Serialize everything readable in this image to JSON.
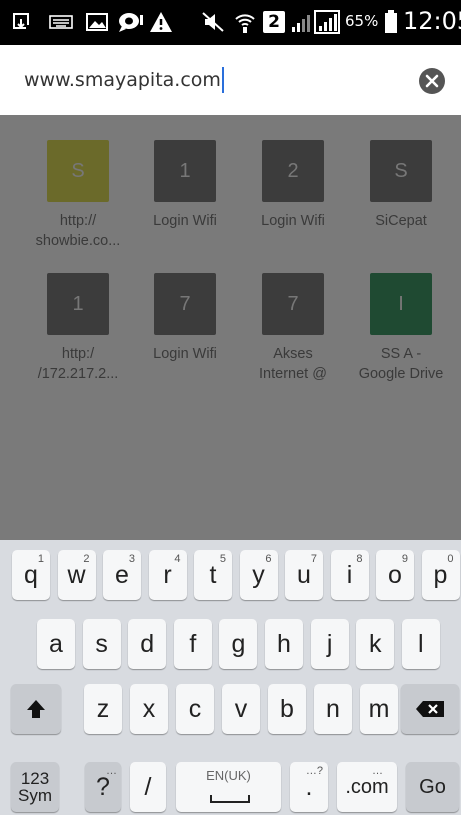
{
  "status_bar": {
    "battery_percent": "65%",
    "time": "12:05",
    "sim_badge": "2",
    "icons": [
      "download-icon",
      "keyboard-icon",
      "image-icon",
      "chat-icon",
      "warning-icon",
      "mute-icon",
      "wifi-icon",
      "signal-icon",
      "signal-icon",
      "battery-icon"
    ]
  },
  "url_bar": {
    "value": "www.smayapita.com",
    "clear_icon": "close-circle-icon"
  },
  "shortcuts": [
    {
      "letter": "S",
      "label": "http://\nshowbie.co...",
      "color": "#6b6a2a"
    },
    {
      "letter": "1",
      "label": "Login Wifi",
      "color": "#3c3c3c"
    },
    {
      "letter": "2",
      "label": "Login Wifi",
      "color": "#3c3c3c"
    },
    {
      "letter": "S",
      "label": "SiCepat",
      "color": "#3c3c3c"
    },
    {
      "letter": "1",
      "label": "http:/\n/172.217.2...",
      "color": "#3c3c3c"
    },
    {
      "letter": "7",
      "label": "Login Wifi",
      "color": "#3c3c3c"
    },
    {
      "letter": "7",
      "label": "Akses\nInternet @",
      "color": "#3c3c3c"
    },
    {
      "letter": "I",
      "label": "SS A -\nGoogle Drive",
      "color": "#1f4a32"
    }
  ],
  "keyboard": {
    "row1": [
      {
        "k": "q",
        "h": "1"
      },
      {
        "k": "w",
        "h": "2"
      },
      {
        "k": "e",
        "h": "3"
      },
      {
        "k": "r",
        "h": "4"
      },
      {
        "k": "t",
        "h": "5"
      },
      {
        "k": "y",
        "h": "6"
      },
      {
        "k": "u",
        "h": "7"
      },
      {
        "k": "i",
        "h": "8"
      },
      {
        "k": "o",
        "h": "9"
      },
      {
        "k": "p",
        "h": "0"
      }
    ],
    "row2": [
      "a",
      "s",
      "d",
      "f",
      "g",
      "h",
      "j",
      "k",
      "l"
    ],
    "row3": [
      "z",
      "x",
      "c",
      "v",
      "b",
      "n",
      "m"
    ],
    "sym_top": "123",
    "sym_bottom": "Sym",
    "question": "?",
    "slash": "/",
    "space_label": "EN(UK)",
    "period": ".",
    "dotcom": ".com",
    "go": "Go"
  }
}
